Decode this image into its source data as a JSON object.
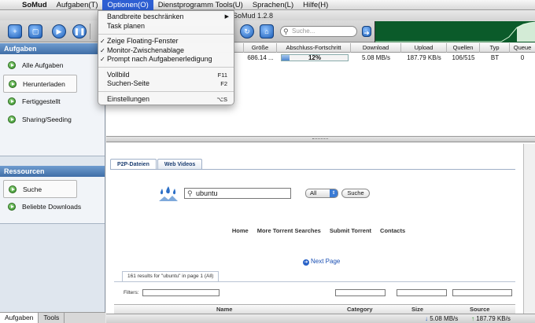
{
  "menubar": {
    "app": "SoMud",
    "items": [
      "Aufgaben(T)",
      "Optionen(O)",
      "Dienstprogramm Tools(U)",
      "Sprachen(L)",
      "Hilfe(H)"
    ]
  },
  "window": {
    "title": "SoMud 1.2.8"
  },
  "toolbar": {
    "search_placeholder": "Suche..."
  },
  "dropdown": {
    "items": [
      {
        "label": "Bandbreite beschränken",
        "submenu": "▶"
      },
      {
        "label": "Task planen"
      },
      {
        "sep": true
      },
      {
        "label": "Zeige Floating-Fenster",
        "checked": "✓"
      },
      {
        "label": "Monitor-Zwischenablage",
        "checked": "✓"
      },
      {
        "label": "Prompt nach Aufgabenerledigung",
        "checked": "✓"
      },
      {
        "sep": true
      },
      {
        "label": "Vollbild",
        "shortcut": "F11"
      },
      {
        "label": "Suchen-Seite",
        "shortcut": "F2"
      },
      {
        "sep": true
      },
      {
        "label": "Einstellungen",
        "shortcut": "⌥S"
      }
    ]
  },
  "sidebar": {
    "tasks_header": "Aufgaben",
    "tasks": [
      "Alle Aufgaben",
      "Herunterladen",
      "Fertiggestellt",
      "Sharing/Seeding"
    ],
    "resources_header": "Ressourcen",
    "resources": [
      "Suche",
      "Beliebte Downloads"
    ],
    "tabs": [
      "Aufgaben",
      "Tools"
    ]
  },
  "table": {
    "columns": [
      "Größe",
      "Abschluss-Fortschritt",
      "Download",
      "Upload",
      "Quellen",
      "Typ",
      "Queue"
    ],
    "row": {
      "size": "686.14 ...",
      "progress": 0.12,
      "progress_label": "12%",
      "download": "5.08 MB/s",
      "upload": "187.79 KB/s",
      "sources": "106/515",
      "type": "BT",
      "queue": "0"
    }
  },
  "browser": {
    "tabs": [
      "P2P-Dateien",
      "Web Videos"
    ],
    "query": "ubuntu",
    "select_value": "All",
    "search_button": "Suche",
    "nav": [
      "Home",
      "More Torrent Searches",
      "Submit Torrent",
      "Contacts"
    ],
    "next_page": "Next Page",
    "results_tab": "161 results for \"ubuntu\" in page 1 (All)",
    "filters_label": "Filters:",
    "result_columns": [
      "Name",
      "Category",
      "Size",
      "Source"
    ]
  },
  "status": {
    "download": "5.08 MB/s",
    "upload": "187.79 KB/s"
  }
}
